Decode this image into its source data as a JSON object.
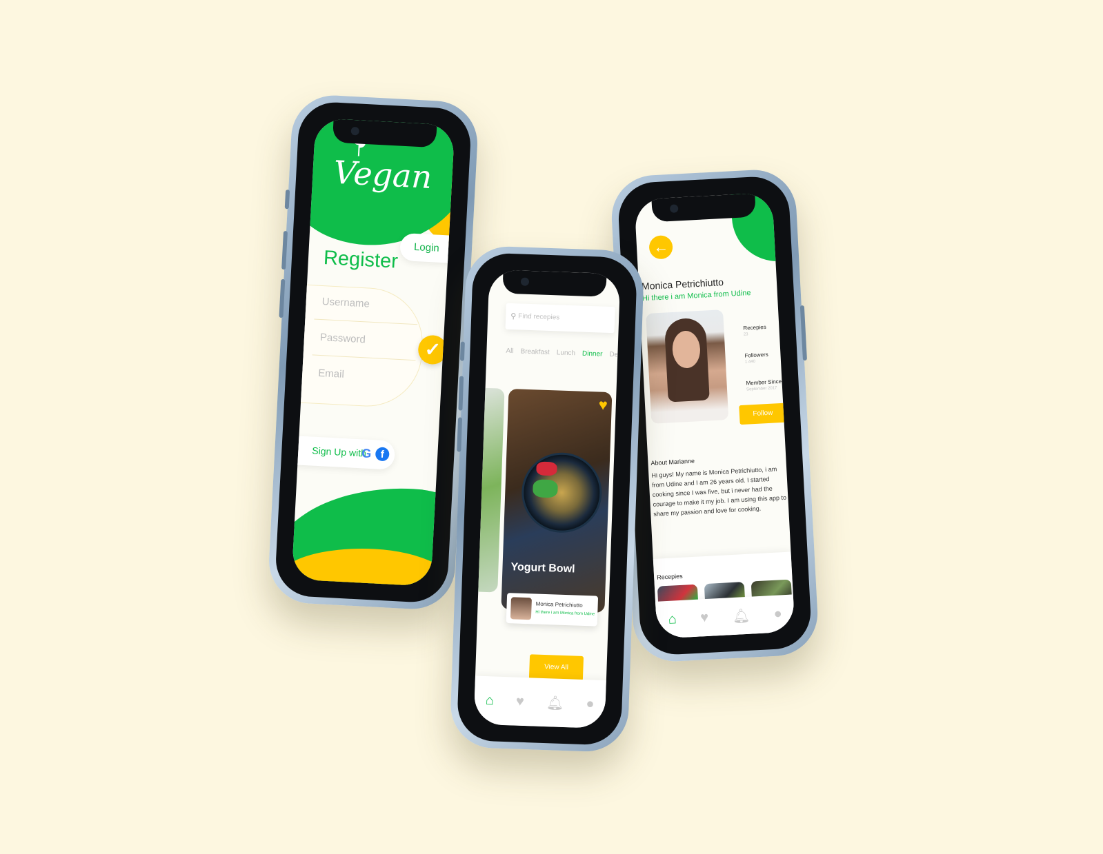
{
  "register_screen": {
    "logo_text": "Vegan",
    "login_tab": "Login",
    "title": "Register",
    "username_placeholder": "Username",
    "password_placeholder": "Password",
    "email_placeholder": "Email",
    "signup_with": "Sign Up with",
    "google_letter": "G",
    "facebook_letter": "f"
  },
  "home_screen": {
    "search_placeholder": "Find recepies",
    "categories": [
      "All",
      "Breakfast",
      "Lunch",
      "Dinner",
      "Dessert"
    ],
    "active_category": "Dinner",
    "featured_title": "Yogurt Bowl",
    "author_name": "Monica Petrichiutto",
    "author_bio": "Hi there i am Monica from Udine",
    "view_all": "View All"
  },
  "profile_screen": {
    "name": "Monica Petrichiutto",
    "bio": "Hi there i am Monica from Udine",
    "stats": {
      "recepies_label": "Recepies",
      "recepies_value": "23",
      "followers_label": "Followers",
      "followers_value": "1.440",
      "member_label": "Member Since",
      "member_value": "September 2017"
    },
    "follow_label": "Follow",
    "about_title": "About Marianne",
    "about_text": "Hi guys! My name is Monica Petrichiutto, i am from Udine and I am 26 years old. I started cooking since I was five, but i never had the courage to make it my job. I am using this app to share my passion and love for cooking.",
    "recepies_title": "Recepies"
  },
  "colors": {
    "green": "#0fbd4a",
    "yellow": "#ffc700",
    "background": "#fdf7e0"
  }
}
